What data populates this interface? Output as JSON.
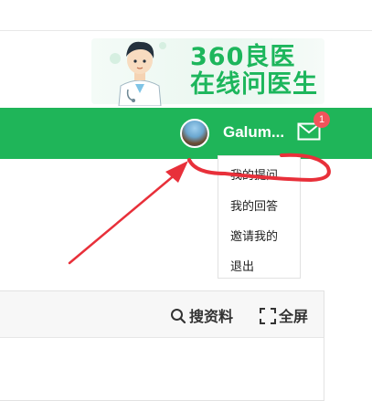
{
  "banner": {
    "brand_line1": "360良医",
    "brand_line2": "在线问医生",
    "brand_color": "#1db65c"
  },
  "navbar": {
    "color": "#1fb559",
    "username": "Galum...",
    "mail_icon": "mail-icon",
    "notification_count": "1"
  },
  "user_menu": {
    "items": [
      "我的提问",
      "我的回答",
      "邀请我的",
      "退出"
    ]
  },
  "panel": {
    "search_label": "搜资料",
    "fullscreen_label": "全屏",
    "search_icon": "search-icon",
    "fullscreen_icon": "fullscreen-icon"
  },
  "annotation": {
    "color": "#e8303a",
    "shapes": [
      "arrow",
      "circled-highlight"
    ]
  }
}
